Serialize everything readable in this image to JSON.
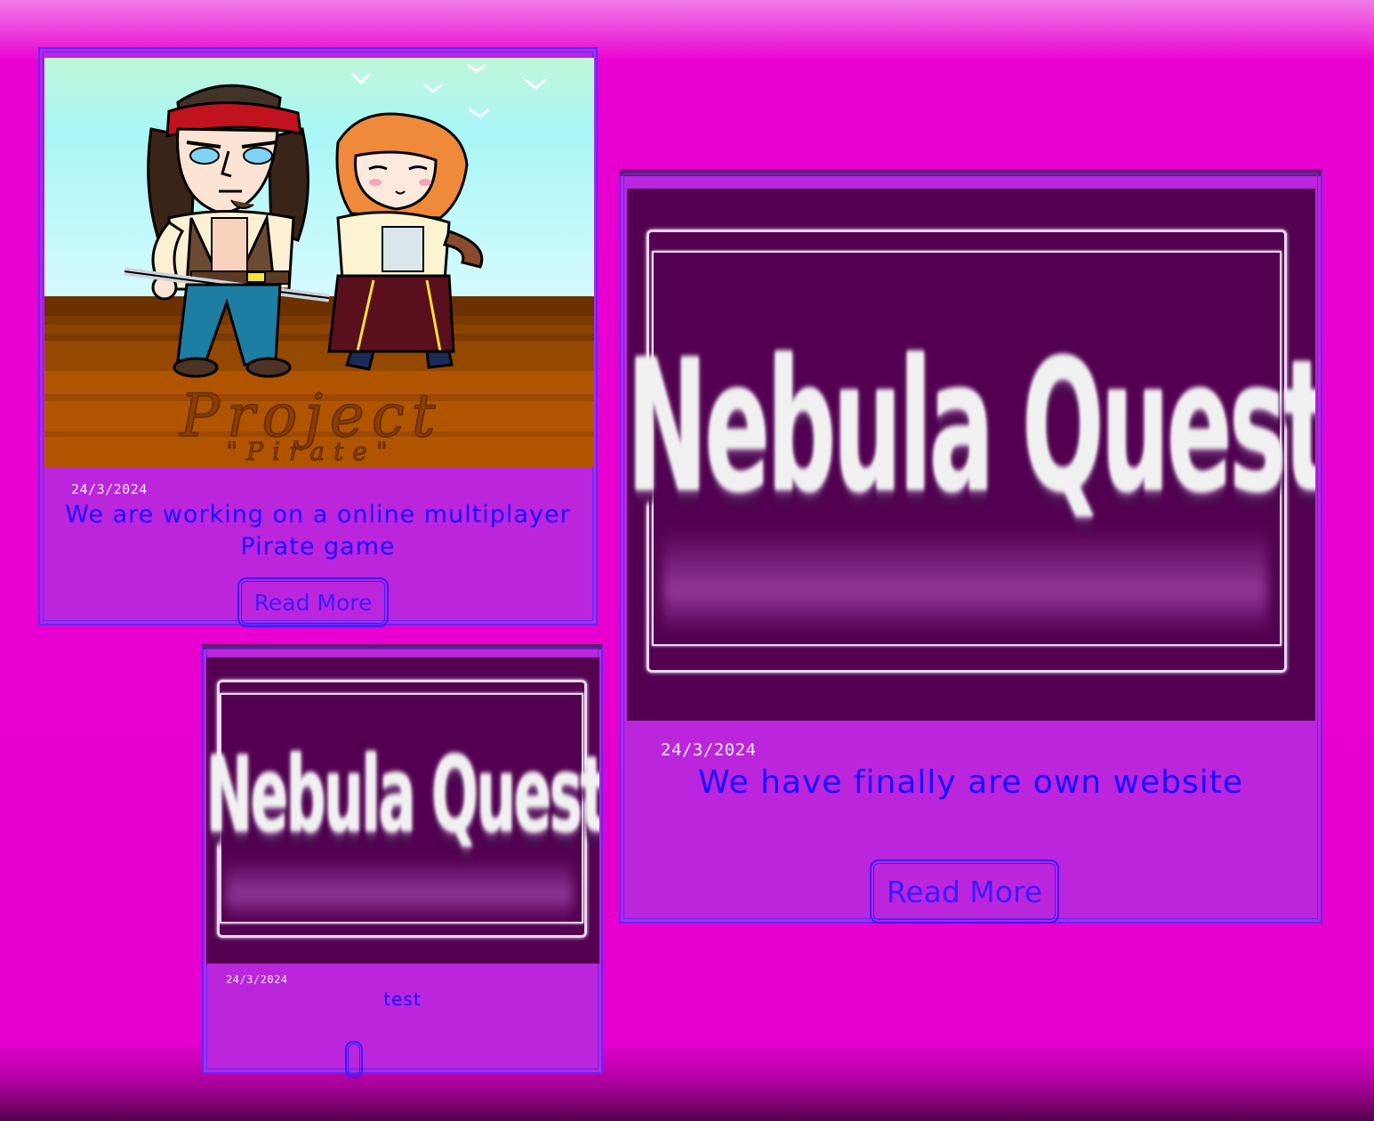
{
  "posts": [
    {
      "date": "24/3/2024",
      "title": "We are working on a online multiplayer Pirate game",
      "button_label": "Read More",
      "image": {
        "alt_text": "Project \"Pirate\"",
        "watermark_line1": "Project",
        "watermark_line2": "\"Pirate\""
      }
    },
    {
      "date": "24/3/2024",
      "title": "We have finally are own website",
      "button_label": "Read More",
      "image": {
        "logo_text": "Nebula Quest Ent."
      }
    },
    {
      "date": "24/3/2024",
      "title": "test",
      "button_label": "",
      "image": {
        "logo_text": "Nebula Quest Ent."
      }
    }
  ],
  "colors": {
    "background": "#e600d0",
    "card": "#bb25dc",
    "border": "#5a2bff",
    "title_text": "#1a12ff",
    "date_text": "#f4e9ff",
    "logo_background": "#530051"
  }
}
